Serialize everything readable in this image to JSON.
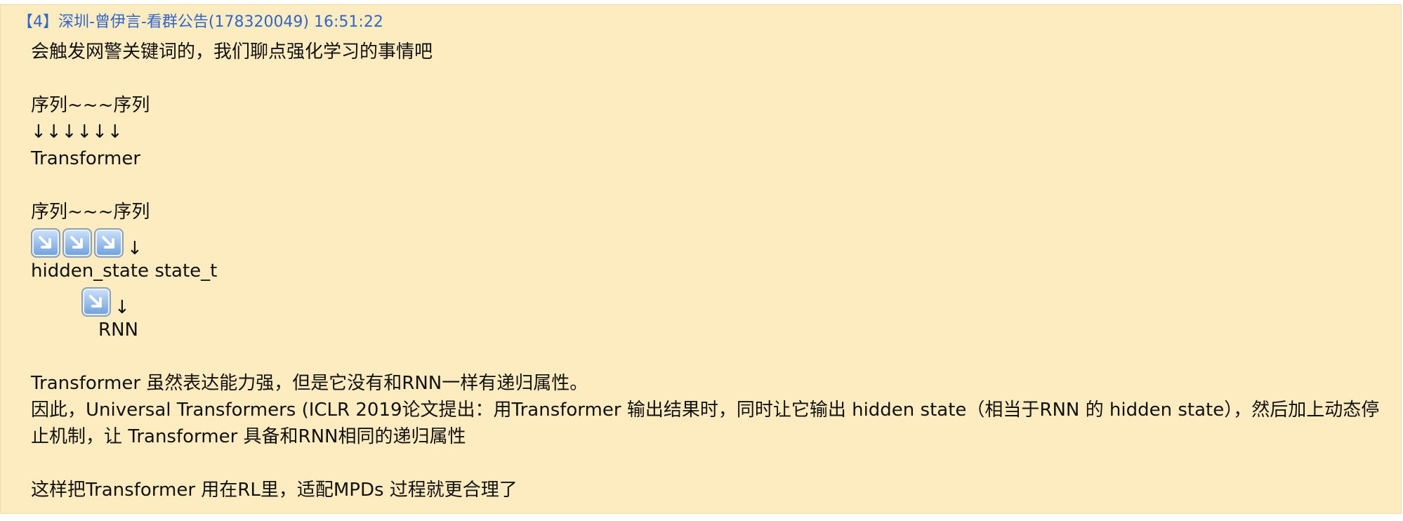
{
  "header": {
    "text": "【4】深圳-曾伊言-看群公告(178320049) 16:51:22"
  },
  "message": {
    "line1": "会触发网警关键词的，我们聊点强化学习的事情吧",
    "seq1": "序列~~~序列",
    "arrows_down": "↓↓↓↓↓↓",
    "transformer": "Transformer",
    "seq2": "序列~~~序列",
    "emoji_trailing_arrow": "↓",
    "hidden_state": "hidden_state state_t",
    "emoji2_trailing_arrow": "↓",
    "rnn": "RNN",
    "para1": "Transformer 虽然表达能力强，但是它没有和RNN一样有递归属性。",
    "para2": "因此，Universal Transformers (ICLR 2019论文提出：用Transformer 输出结果时，同时让它输出 hidden state（相当于RNN 的 hidden state），然后加上动态停止机制，让 Transformer 具备和RNN相同的递归属性",
    "para3": "这样把Transformer 用在RL里，适配MPDs 过程就更合理了"
  },
  "icons": {
    "emoji": "arrow-down-right-emoji-icon"
  },
  "colors": {
    "background": "#feecc1",
    "header_text": "#2d66cf",
    "body_text": "#111111"
  }
}
